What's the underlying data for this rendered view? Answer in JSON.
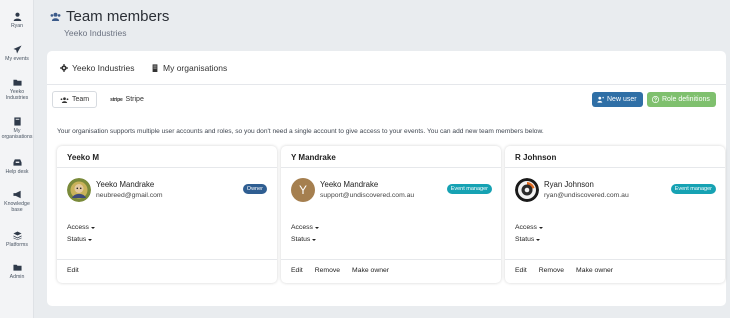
{
  "sidebar": {
    "items": [
      {
        "label": "Ryan",
        "icon": "user-icon"
      },
      {
        "label": "My events",
        "icon": "paper-plane-icon"
      },
      {
        "label": "Yeeko Industries",
        "icon": "folder-icon"
      },
      {
        "label": "My organisations",
        "icon": "book-icon"
      },
      {
        "label": "Help desk",
        "icon": "inbox-icon"
      },
      {
        "label": "Knowledge base",
        "icon": "bullhorn-icon"
      },
      {
        "label": "Platforms",
        "icon": "layers-icon"
      },
      {
        "label": "Admin",
        "icon": "folder-icon"
      }
    ]
  },
  "header": {
    "title": "Team members",
    "subtitle": "Yeeko Industries"
  },
  "org_tabs": [
    {
      "label": "Yeeko Industries",
      "icon": "gear-icon"
    },
    {
      "label": "My organisations",
      "icon": "building-icon"
    }
  ],
  "sub_tabs": {
    "team_label": "Team",
    "stripe_mark": "stripe",
    "stripe_label": "Stripe"
  },
  "buttons": {
    "new_user": "New user",
    "role_definitions": "Role definitions"
  },
  "intro": "Your organisation supports multiple user accounts and roles, so you don't need a single account to give access to your events. You can add new team members below.",
  "members": [
    {
      "card_title": "Yeeko M",
      "name": "Yeeko Mandrake",
      "email": "neubreed@gmail.com",
      "role": "Owner",
      "avatar_letter": "",
      "access_label": "Access",
      "status_label": "Status",
      "actions": [
        "Edit"
      ]
    },
    {
      "card_title": "Y Mandrake",
      "name": "Yeeko Mandrake",
      "email": "support@undiscovered.com.au",
      "role": "Event manager",
      "avatar_letter": "Y",
      "access_label": "Access",
      "status_label": "Status",
      "actions": [
        "Edit",
        "Remove",
        "Make owner"
      ]
    },
    {
      "card_title": "R Johnson",
      "name": "Ryan Johnson",
      "email": "ryan@undiscovered.com.au",
      "role": "Event manager",
      "avatar_letter": "",
      "access_label": "Access",
      "status_label": "Status",
      "actions": [
        "Edit",
        "Remove",
        "Make owner"
      ]
    }
  ],
  "colors": {
    "primary_button": "#2f6fa6",
    "role_button": "#7fc06e",
    "owner_badge": "#2f5e92",
    "event_manager_badge": "#16a2b3"
  }
}
